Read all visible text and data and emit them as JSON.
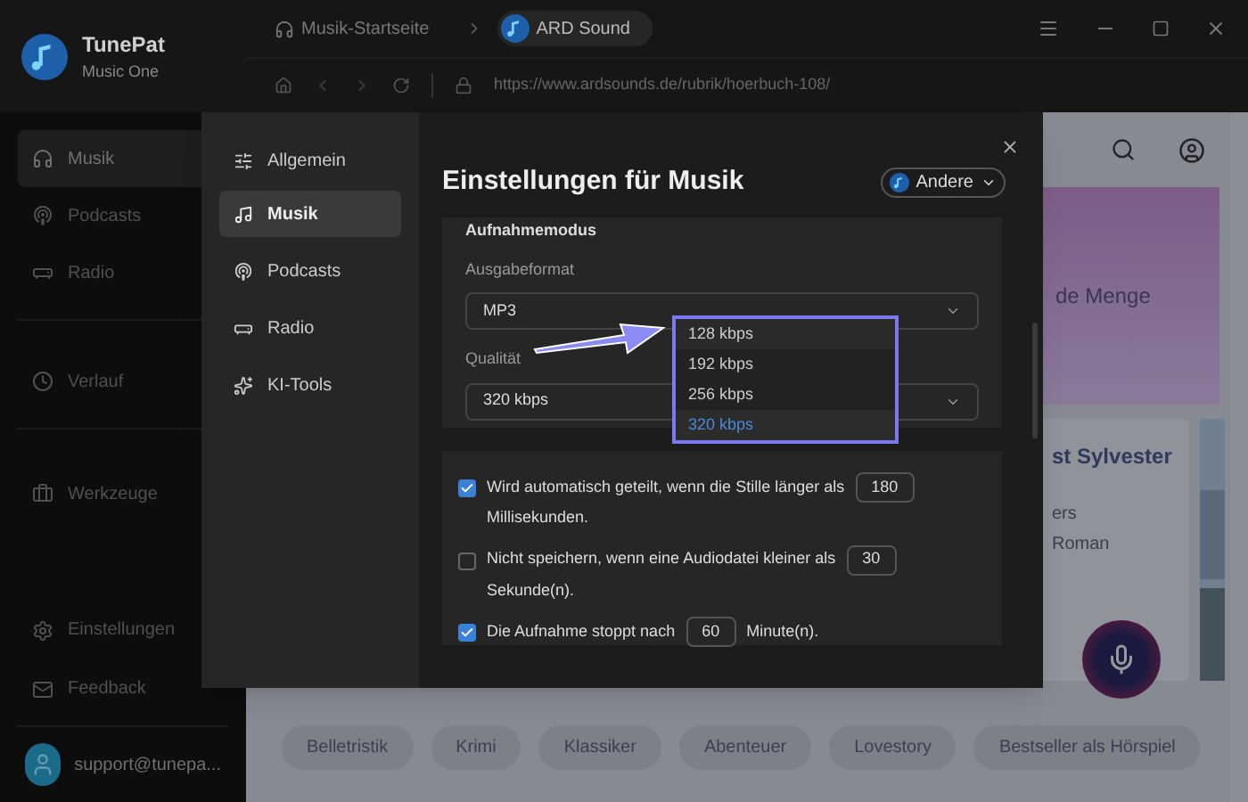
{
  "app": {
    "name": "TunePat",
    "subtitle": "Music One"
  },
  "tabs": [
    {
      "label": "Musik-Startseite",
      "selected": false
    },
    {
      "label": "ARD Sound",
      "selected": true
    }
  ],
  "address_bar": {
    "url": "https://www.ardsounds.de/rubrik/hoerbuch-108/"
  },
  "sidebar": {
    "items": [
      {
        "label": "Musik",
        "selected": true
      },
      {
        "label": "Podcasts",
        "selected": false
      },
      {
        "label": "Radio",
        "selected": false
      },
      {
        "label": "Verlauf",
        "selected": false
      },
      {
        "label": "Werkzeuge",
        "selected": false
      }
    ],
    "bottom_items": [
      "Einstellungen",
      "Feedback"
    ],
    "account": "support@tunepa..."
  },
  "page": {
    "banner_text": "de Menge",
    "card_title": "st Sylvester",
    "card_lines": [
      "ers",
      "Roman"
    ],
    "chips": [
      "Belletristik",
      "Krimi",
      "Klassiker",
      "Abenteuer",
      "Lovestory",
      "Bestseller als Hörspiel"
    ]
  },
  "dialog": {
    "nav": [
      {
        "label": "Allgemein",
        "selected": false
      },
      {
        "label": "Musik",
        "selected": true
      },
      {
        "label": "Podcasts",
        "selected": false
      },
      {
        "label": "Radio",
        "selected": false
      },
      {
        "label": "KI-Tools",
        "selected": false
      }
    ],
    "title": "Einstellungen für Musik",
    "source_button": "Andere",
    "section": "Aufnahmemodus",
    "format_label": "Ausgabeformat",
    "format_value": "MP3",
    "quality_label": "Qualität",
    "quality_value": "320 kbps",
    "quality_options": [
      {
        "label": "128 kbps",
        "selected": false
      },
      {
        "label": "192 kbps",
        "selected": false
      },
      {
        "label": "256 kbps",
        "selected": false
      },
      {
        "label": "320 kbps",
        "selected": true
      }
    ],
    "options": [
      {
        "text": "Wird automatisch geteilt, wenn die Stille länger als",
        "value": "180",
        "unit": "Millisekunden.",
        "checked": true
      },
      {
        "text": "Nicht speichern, wenn eine Audiodatei kleiner als",
        "value": "30",
        "unit": "Sekunde(n).",
        "checked": false
      },
      {
        "text": "Die Aufnahme stoppt nach",
        "value": "60",
        "unit": "Minute(n).",
        "checked": true
      }
    ]
  }
}
